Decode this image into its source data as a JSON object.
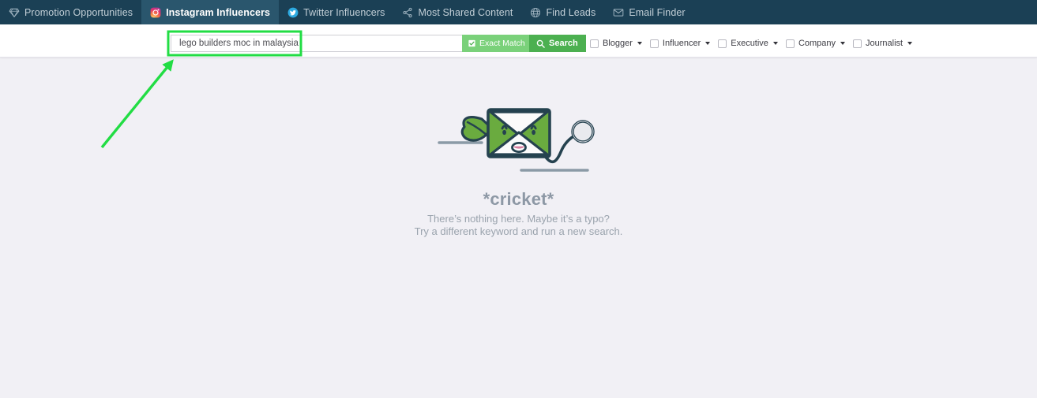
{
  "nav": {
    "items": [
      {
        "label": "Promotion Opportunities",
        "icon": "diamond-icon",
        "active": false
      },
      {
        "label": "Instagram Influencers",
        "icon": "instagram-icon",
        "active": true
      },
      {
        "label": "Twitter Influencers",
        "icon": "twitter-icon",
        "active": false
      },
      {
        "label": "Most Shared Content",
        "icon": "share-icon",
        "active": false
      },
      {
        "label": "Find Leads",
        "icon": "globe-icon",
        "active": false
      },
      {
        "label": "Email Finder",
        "icon": "envelope-icon",
        "active": false
      }
    ]
  },
  "search": {
    "value": "lego builders moc in malaysia",
    "placeholder": "",
    "exact_match_label": "Exact Match",
    "exact_match_checked": true,
    "search_label": "Search"
  },
  "filters": [
    {
      "label": "Blogger",
      "checked": false
    },
    {
      "label": "Influencer",
      "checked": false
    },
    {
      "label": "Executive",
      "checked": false
    },
    {
      "label": "Company",
      "checked": false
    },
    {
      "label": "Journalist",
      "checked": false
    }
  ],
  "empty_state": {
    "title": "*cricket*",
    "line1": "There’s nothing here. Maybe it’s a typo?",
    "line2": "Try a different keyword and run a new search.",
    "illustration": "sad-envelope-with-magnifier-icon"
  },
  "colors": {
    "nav_bg": "#1b4055",
    "nav_active_bg": "#2a566d",
    "page_bg": "#f1f0f5",
    "exact_match_green": "#7ad17a",
    "search_green": "#4cb050",
    "annotation_green": "#22dd44",
    "mascot_green": "#6aab3f",
    "mascot_outline": "#25424f",
    "empty_text": "#9aa3ad"
  },
  "annotations": {
    "highlight_box_label": "search-field-highlight",
    "arrow_label": "pointer-arrow-to-search-field"
  }
}
